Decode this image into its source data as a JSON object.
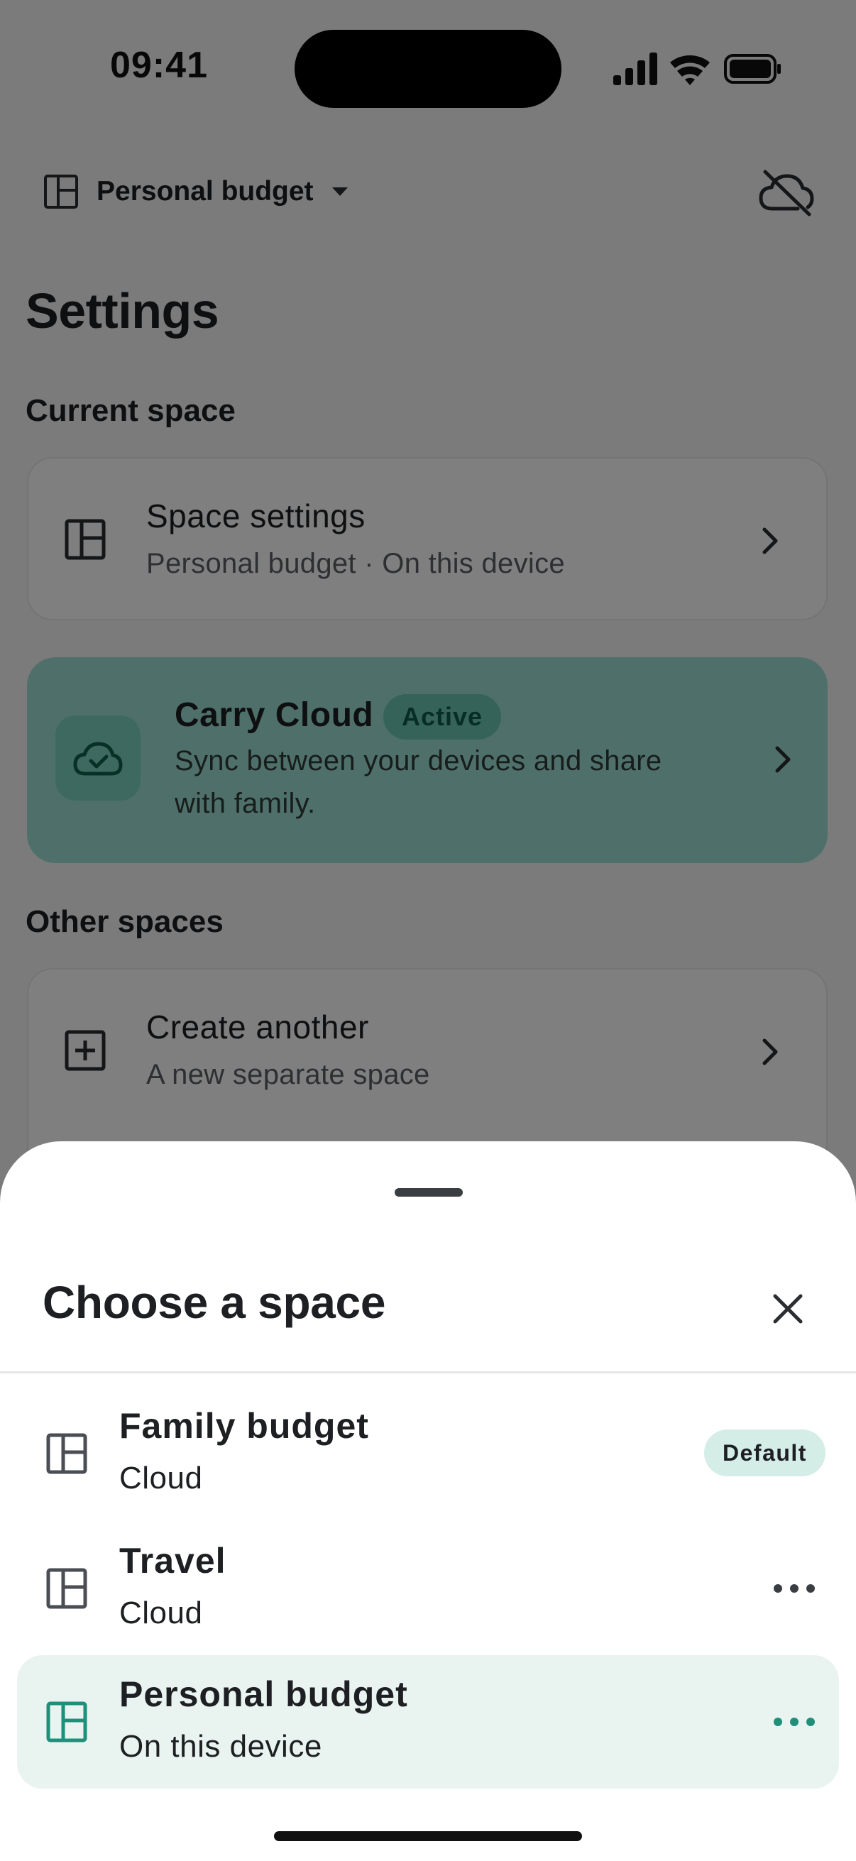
{
  "status_bar": {
    "time": "09:41"
  },
  "header": {
    "space_selector_label": "Personal budget",
    "sync_icon": "cloud-off-icon"
  },
  "settings": {
    "title": "Settings",
    "current_space_label": "Current space",
    "space_settings": {
      "title": "Space settings",
      "subtitle": "Personal budget · On this device"
    },
    "carry_cloud": {
      "title": "Carry Cloud",
      "badge": "Active",
      "description_line1": "Sync between your devices and share",
      "description_line2": "with family."
    },
    "other_spaces_label": "Other spaces",
    "create_another": {
      "title": "Create another",
      "subtitle": "A new separate space"
    }
  },
  "sheet": {
    "title": "Choose a space",
    "spaces": [
      {
        "name": "Family budget",
        "kind": "Cloud",
        "badge": "Default"
      },
      {
        "name": "Travel",
        "kind": "Cloud"
      },
      {
        "name": "Personal budget",
        "kind": "On this device",
        "selected": true
      }
    ]
  },
  "colors": {
    "accent": "#1f8f7a",
    "selected_row": "#e9f3f0",
    "cloud_card": "#9fe1d4"
  }
}
